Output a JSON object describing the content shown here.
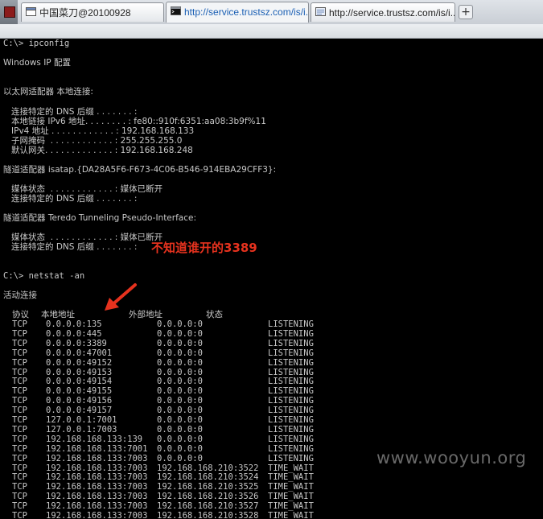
{
  "tabs": [
    {
      "label": "中国菜刀@20100928",
      "icon": "window-icon",
      "active": false
    },
    {
      "label": "http://service.trustsz.com/is/i...",
      "icon": "console-icon",
      "active": true
    },
    {
      "label": "http://service.trustsz.com/is/i...",
      "icon": "page-icon",
      "active": false
    }
  ],
  "new_tab_label": "+",
  "console": {
    "lines": [
      {
        "text": "C:\\> ipconfig"
      },
      {
        "text": "Windows IP 配置"
      },
      {
        "text": "以太网适配器 本地连接:"
      },
      {
        "text": "   连接特定的 DNS 后缀 . . . . . . . :"
      },
      {
        "text": "   本地链接 IPv6 地址. . . . . . . . : fe80::910f:6351:aa08:3b9f%11"
      },
      {
        "text": "   IPv4 地址 . . . . . . . . . . . . : 192.168.168.133"
      },
      {
        "text": "   子网掩码  . . . . . . . . . . . . : 255.255.255.0"
      },
      {
        "text": "   默认网关. . . . . . . . . . . . . : 192.168.168.248"
      },
      {
        "text": "隧道适配器 isatap.{DA28A5F6-F673-4C06-B546-914EBA29CFF3}:"
      },
      {
        "text": "   媒体状态  . . . . . . . . . . . . : 媒体已断开"
      },
      {
        "text": "   连接特定的 DNS 后缀 . . . . . . . :"
      },
      {
        "text": "隧道适配器 Teredo Tunneling Pseudo-Interface:"
      },
      {
        "text": "   媒体状态  . . . . . . . . . . . . : 媒体已断开"
      },
      {
        "text": "   连接特定的 DNS 后缀 . . . . . . . :"
      },
      {
        "text": "C:\\> netstat -an"
      },
      {
        "text": "活动连接"
      }
    ],
    "netstat": {
      "headers": [
        "协议",
        "本地地址",
        "外部地址",
        "状态"
      ],
      "rows": [
        [
          "TCP",
          "0.0.0.0:135",
          "0.0.0.0:0",
          "LISTENING"
        ],
        [
          "TCP",
          "0.0.0.0:445",
          "0.0.0.0:0",
          "LISTENING"
        ],
        [
          "TCP",
          "0.0.0.0:3389",
          "0.0.0.0:0",
          "LISTENING"
        ],
        [
          "TCP",
          "0.0.0.0:47001",
          "0.0.0.0:0",
          "LISTENING"
        ],
        [
          "TCP",
          "0.0.0.0:49152",
          "0.0.0.0:0",
          "LISTENING"
        ],
        [
          "TCP",
          "0.0.0.0:49153",
          "0.0.0.0:0",
          "LISTENING"
        ],
        [
          "TCP",
          "0.0.0.0:49154",
          "0.0.0.0:0",
          "LISTENING"
        ],
        [
          "TCP",
          "0.0.0.0:49155",
          "0.0.0.0:0",
          "LISTENING"
        ],
        [
          "TCP",
          "0.0.0.0:49156",
          "0.0.0.0:0",
          "LISTENING"
        ],
        [
          "TCP",
          "0.0.0.0:49157",
          "0.0.0.0:0",
          "LISTENING"
        ],
        [
          "TCP",
          "127.0.0.1:7001",
          "0.0.0.0:0",
          "LISTENING"
        ],
        [
          "TCP",
          "127.0.0.1:7003",
          "0.0.0.0:0",
          "LISTENING"
        ],
        [
          "TCP",
          "192.168.168.133:139",
          "0.0.0.0:0",
          "LISTENING"
        ],
        [
          "TCP",
          "192.168.168.133:7001",
          "0.0.0.0:0",
          "LISTENING"
        ],
        [
          "TCP",
          "192.168.168.133:7003",
          "0.0.0.0:0",
          "LISTENING"
        ],
        [
          "TCP",
          "192.168.168.133:7003",
          "192.168.168.210:3522",
          "TIME_WAIT"
        ],
        [
          "TCP",
          "192.168.168.133:7003",
          "192.168.168.210:3524",
          "TIME_WAIT"
        ],
        [
          "TCP",
          "192.168.168.133:7003",
          "192.168.168.210:3525",
          "TIME_WAIT"
        ],
        [
          "TCP",
          "192.168.168.133:7003",
          "192.168.168.210:3526",
          "TIME_WAIT"
        ],
        [
          "TCP",
          "192.168.168.133:7003",
          "192.168.168.210:3527",
          "TIME_WAIT"
        ],
        [
          "TCP",
          "192.168.168.133:7003",
          "192.168.168.210:3528",
          "TIME_WAIT"
        ]
      ]
    }
  },
  "annotation": "不知道谁开的3389",
  "watermark": "www.wooyun.org",
  "colors": {
    "console_bg": "#000000",
    "console_text": "#c8c8c8",
    "annotation": "#e6321e",
    "url_text": "#1a5fb4"
  }
}
